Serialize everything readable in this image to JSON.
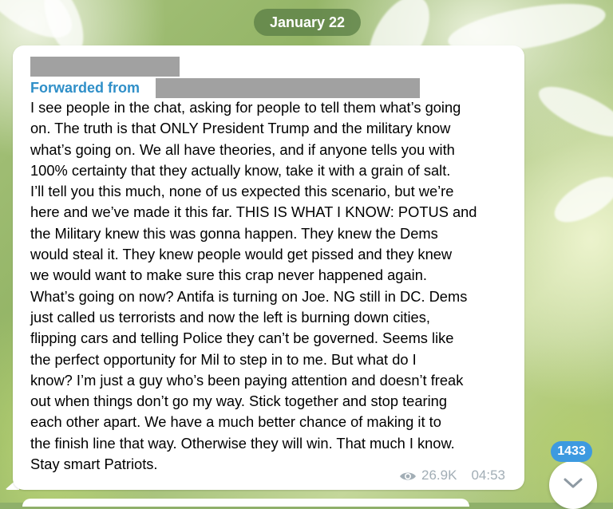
{
  "chat": {
    "date_label": "January 22",
    "message": {
      "forwarded_label": "Forwarded from",
      "lines": [
        "I see people in the chat, asking for people to tell them what’s going",
        "on. The truth is that ONLY President Trump and the military know",
        "what’s going on. We all have theories, and if anyone tells you with",
        "100% certainty that they actually know, take it with a grain of salt.",
        "I’ll tell you this much, none of us expected this scenario, but we’re",
        "here and we’ve made it this far. THIS IS WHAT I KNOW: POTUS  and",
        "the Military knew this was gonna happen. They knew the Dems",
        "would steal it. They knew people would get pissed and they knew",
        "we would want to make sure this crap never happened again.",
        "What’s going on now? Antifa is turning on Joe. NG still in DC. Dems",
        "just called us terrorists and now the left is burning down cities,",
        "flipping cars and telling Police they can’t be governed. Seems like",
        "the perfect opportunity for Mil to step in to me. But what do I",
        "know? I’m just a guy who’s been paying attention and doesn’t freak",
        "out when things don’t go my way. Stick together and stop tearing",
        "each other apart. We have a much better chance of making it to",
        "the finish line that way. Otherwise they will win. That much I know.",
        "Stay smart Patriots."
      ],
      "views": "26.9K",
      "time": "04:53",
      "views_icon": "eye-icon"
    },
    "unread_count": "1433",
    "scroll_button_icon": "chevron-down-icon"
  },
  "colors": {
    "forwarded_label": "#2f8fc8",
    "badge": "#3d9ae0",
    "date_pill": "#5c8046",
    "meta_text": "#a2aeb6",
    "redaction": "#a1a1a1"
  }
}
